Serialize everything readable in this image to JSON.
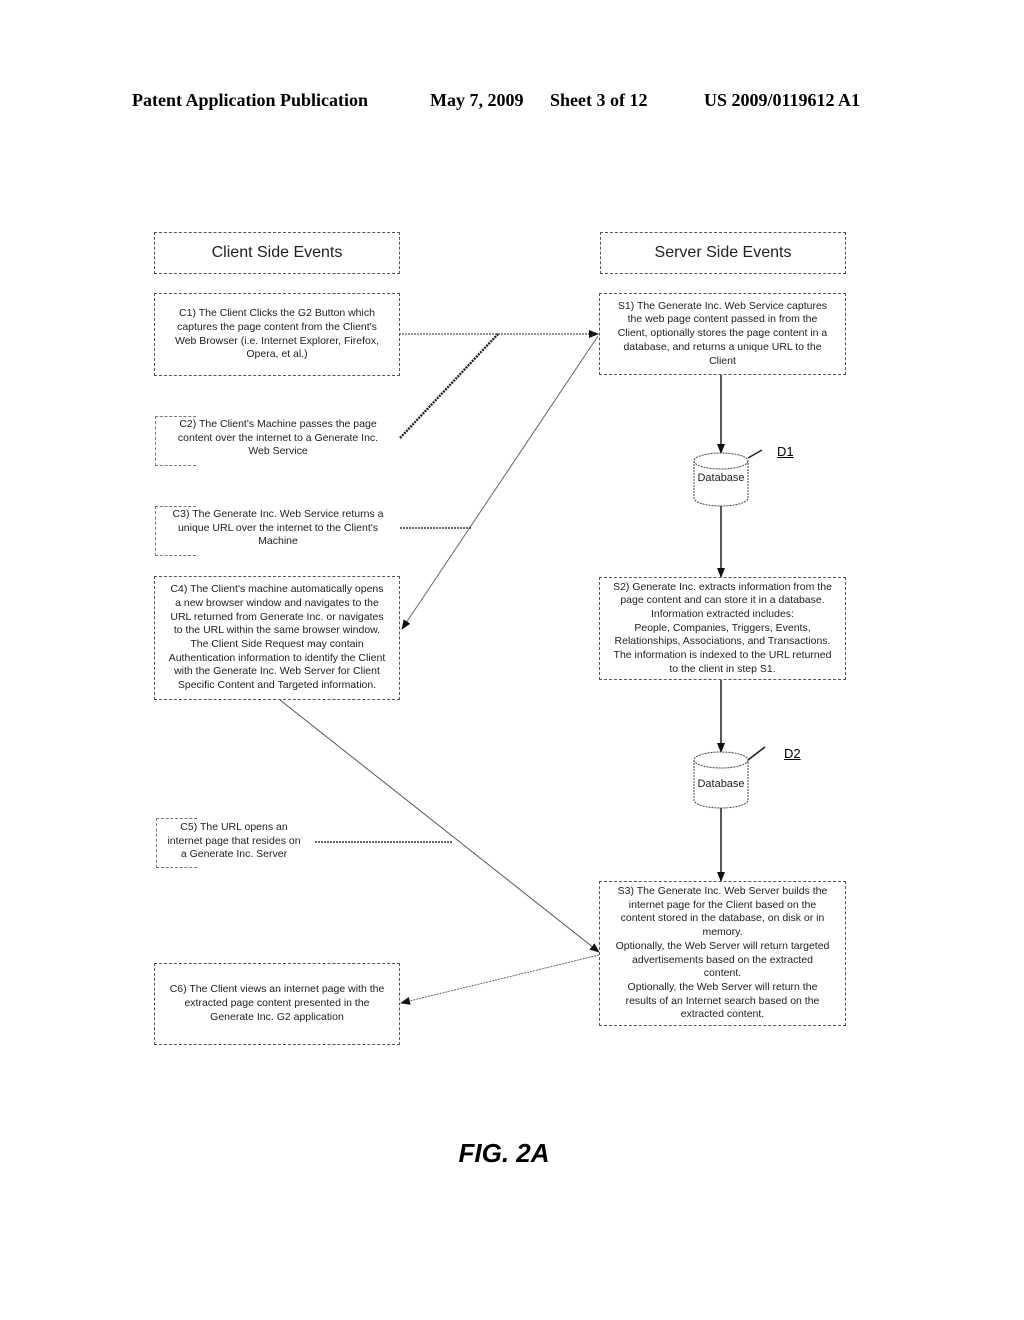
{
  "header": {
    "publication": "Patent Application Publication",
    "date": "May 7, 2009",
    "sheet": "Sheet 3 of 12",
    "number": "US 2009/0119612 A1"
  },
  "columns": {
    "client_title": "Client Side Events",
    "server_title": "Server Side Events"
  },
  "client_steps": {
    "c1": "C1) The Client Clicks the G2 Button which\ncaptures the page content from the Client's\nWeb Browser (i.e. Internet Explorer, Firefox,\nOpera, et al.)",
    "c2": "C2) The Client's Machine passes the page\ncontent over the internet to a Generate Inc.\nWeb Service",
    "c3": "C3) The Generate Inc. Web Service returns a\nunique URL over the internet to the Client's\nMachine",
    "c4": "C4) The Client's machine automatically opens\na new browser window and navigates to the\nURL returned from Generate Inc. or navigates\nto the URL within the same browser window.\nThe Client Side Request may contain\nAuthentication information to identify the Client\nwith the Generate Inc. Web Server for Client\nSpecific Content and Targeted information.",
    "c5": "C5) The URL opens an\ninternet page that resides on\na Generate Inc. Server",
    "c6": "C6) The Client views an internet page with the\nextracted page content presented in the\nGenerate Inc. G2 application"
  },
  "server_steps": {
    "s1": "S1) The Generate Inc. Web Service captures\nthe web page content passed in from the\nClient, optionally stores the page content in a\ndatabase, and returns a unique URL to the\nClient",
    "s2": "S2) Generate Inc. extracts information from the\npage content and can store it in a database.\nInformation extracted includes:\nPeople, Companies, Triggers, Events,\nRelationships, Associations, and Transactions.\nThe information is indexed to the URL returned\nto the client in step S1.",
    "s3": "S3) The Generate Inc. Web Server builds the\ninternet page for the Client based on the\ncontent stored in the database, on disk or in\nmemory.\nOptionally, the Web Server will return targeted\nadvertisements based on the extracted\ncontent.\nOptionally, the Web Server will return the\nresults of an Internet search based on the\nextracted content."
  },
  "databases": {
    "d1_label": "Database",
    "d1_ref": "D1",
    "d2_label": "Database",
    "d2_ref": "D2"
  },
  "figure_label": "FIG. 2A"
}
